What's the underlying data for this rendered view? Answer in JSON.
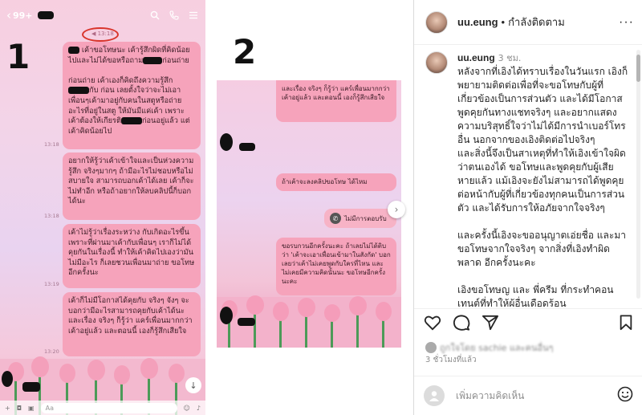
{
  "chat1": {
    "back_glyph": "‹",
    "unread_count": "99+",
    "marker": "1",
    "circled_label": "◀ 13:18",
    "bubbles": [
      {
        "pre": "",
        "text": " เค้าขอโทษนะ เค้ารู้สึกผิดที่คิดน้อยไปและไม่ได้ขอหรือถาม",
        "mid": "ก่อนถ่าย\n\nก่อนถ่าย เค้าเองก็คิดถึงความรู้สึก",
        "post": "กับ ก่อน เลยตั้งใจว่าจะไม่เอาเพื่อนๆเค้ามาอยู่กับคนในสตูหรือถ่ายอะไรที่อยู่ในสตู ให้มันมีแค่เค้า เพราะเค้าต้องให้เกียรติ",
        "end": "ก่อนอยู่แล้ว แต่เค้าคิดน้อยไป"
      },
      {
        "text": "อยากให้รู้ว่าเค้าเข้าใจและเป็นห่วงความรู้สึก จริงๆมากๆ ถ้ามีอะไรไม่ชอบหรือไม่สบายใจ สามารถบอกเค้าได้เลย เค้าก็จะไม่ทำอีก หรือถ้าอยากให้ลบคลิปนี้ก็บอกได้นะ"
      },
      {
        "text": "เค้าไม่รู้ว่าเรื่องระหว่าง กับเกิดอะไรขึ้น เพราะที่ผ่านมาเค้ากับเพื่อนๆ เราก็ไม่ได้คุยกันในเรื่องนี้ ทำให้เค้าคิดไปเองว่ามันไม่มีอะไร ก็เลยชวนเพื่อนมาถ่าย ขอโทษอีกครั้งนะ"
      },
      {
        "text": "เค้าก็ไม่มีโอกาสได้คุยกับ จริงๆ จังๆ จะบอกว่ามีอะไรสามารถคุยกับเค้าได้นะ และเรื่อง จริงๆ ก็รู้ว่า แคร์เพื่อนมากกว่าเค้าอยู่แล้ว และตอนนี้ เองก็รู้สึกเสียใจ"
      }
    ],
    "timestamps": [
      "13:18",
      "13:18",
      "13:19",
      "13:20"
    ],
    "input_placeholder": "Aa",
    "scroll_glyph": "↓"
  },
  "chat2": {
    "marker": "2",
    "bubbles": [
      {
        "text": "และเรื่อง จริงๆ ก็รู้ว่า แคร์เพื่อนมากกว่าเค้าอยู่แล้ว และตอนนี้ เองก็รู้สึกเสียใจ"
      },
      {
        "text": "ถ้าเค้าจะลงคลิปขอโทษ ได้ไหม"
      },
      {
        "text": "ไม่มีการตอบรับ"
      },
      {
        "text": "ขอรบกวนอีกครั้งนะคะ ถ้าเลยไม่ได้ติบว่า 'เค้าจะเอาเพื่อนเข้ามาในสังกัด' บอกเลยว่าเค้าไม่เคยพูดกับใครที่ไหน และไม่เคยมีความคิดนั้นนะ ขอโทษอีกครั้งนะคะ"
      }
    ],
    "next_glyph": "›"
  },
  "instagram": {
    "username": "uu.eung",
    "follow_label": "กำลังติดตาม",
    "caption_time": "3 ชม.",
    "caption": "หลังจากที่เอิงได้ทราบเรื่องในวันแรก เอิงก็พยายามติดต่อเพื่อที่จะขอโทษกับผู้ที่เกี่ยวข้องเป็นการส่วนตัว และได้มีโอกาสพูดคุยกันทางแชทจริงๆ และอยากแสดงความบริสุทธิ์ใจว่าไม่ได้มีการนำเบอร์โทรอื่น นอกจากของเอิงติดต่อไปจริงๆ\nและสิ่งนี้จึงเป็นสาเหตุที่ทำให้เอิงเข้าใจผิดว่าตนเองได้ ขอโทษและพูดคุยกับผู้เสียหายแล้ว แม้เอิงจะยังไม่สามารถได้พูดคุยต่อหน้ากับผู้ที่เกี่ยวข้องทุกคนเป็นการส่วนตัว และได้รับการให้อภัยจากใจจริงๆ\n\nและครั้งนี้เอิงจะขออนุญาตเอ่ยชื่อ และมาขอโทษจากใจจริงๆ จากสิ่งที่เอิงทำผิดพลาด อีกครั้งนะคะ\n\nเอิงขอโทษญ และ พี่ครีม ที่กระทำคอนเทนต์ที่ทำให้ผู้อื่นเดือดร้อน",
    "likes_text": "ถูกใจโดย sachie และคนอื่นๆ",
    "time_ago": "3 ชั่วโมงที่แล้ว",
    "comment_placeholder": "เพิ่มความคิดเห็น",
    "icons": {
      "like": "heart-icon",
      "comment": "comment-icon",
      "share": "paper-plane-icon",
      "save": "bookmark-icon",
      "emoji": "smiley-icon",
      "more": "more-dots-icon"
    },
    "colors": {
      "text": "#262626",
      "muted": "#8e8e8e",
      "border": "#dbdbdb"
    }
  },
  "colors": {
    "bubble": "#f6a3bb",
    "circle_annotation": "#d9342b"
  }
}
